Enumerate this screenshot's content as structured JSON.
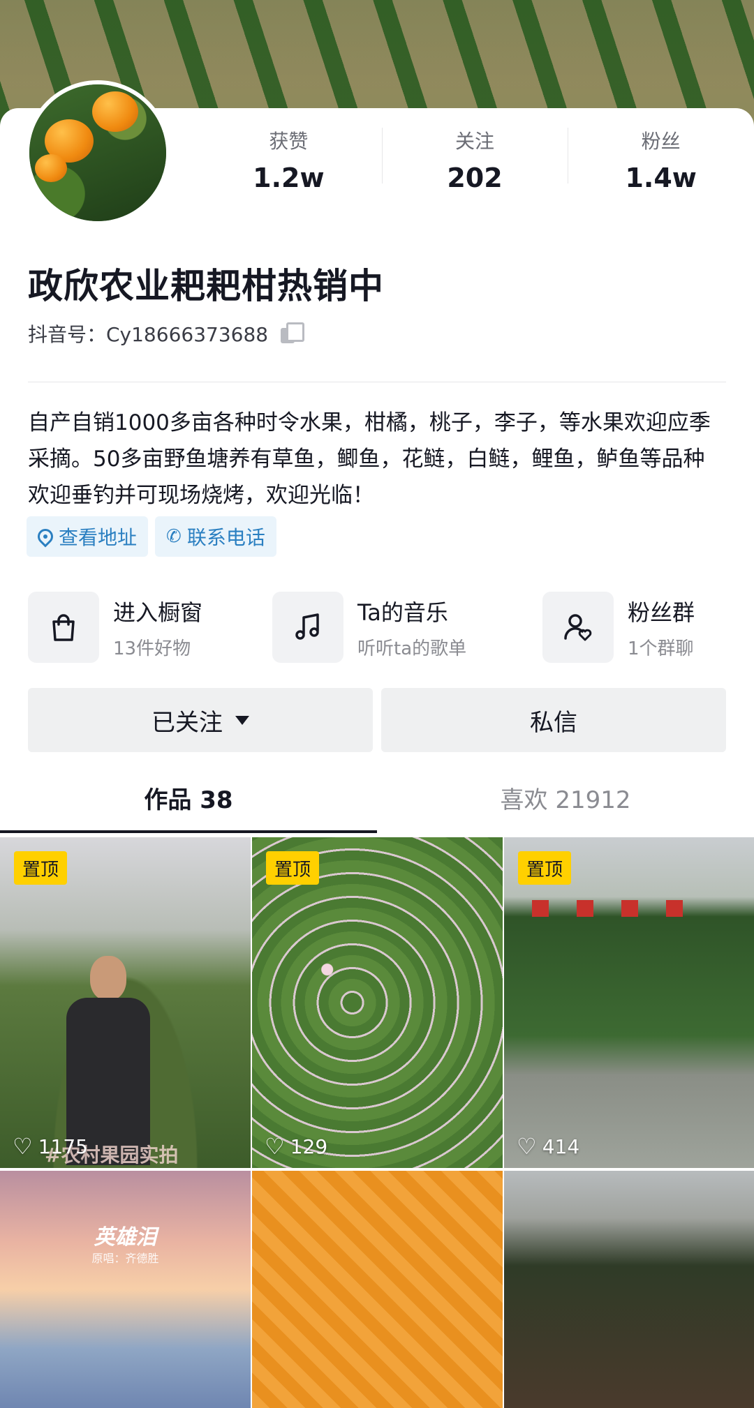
{
  "stats": [
    {
      "label": "获赞",
      "value": "1.2w"
    },
    {
      "label": "关注",
      "value": "202"
    },
    {
      "label": "粉丝",
      "value": "1.4w"
    }
  ],
  "profile": {
    "name": "政欣农业耙耙柑热销中",
    "douyin_id": "抖音号：Cy18666373688",
    "bio": "自产自销1000多亩各种时令水果，柑橘，桃子，李子，等水果欢迎应季采摘。50多亩野鱼塘养有草鱼，鲫鱼，花鲢，白鲢，鲤鱼，鲈鱼等品种欢迎垂钓并可现场烧烤，欢迎光临！"
  },
  "chips": {
    "address": "查看地址",
    "phone": "联系电话"
  },
  "features": [
    {
      "title": "进入橱窗",
      "subtitle": "13件好物",
      "icon": "shopping-bag-icon"
    },
    {
      "title": "Ta的音乐",
      "subtitle": "听听ta的歌单",
      "icon": "music-note-icon"
    },
    {
      "title": "粉丝群",
      "subtitle": "1个群聊",
      "icon": "fan-group-icon"
    }
  ],
  "actions": {
    "followed": "已关注",
    "message": "私信"
  },
  "tabs": [
    {
      "label": "作品 38",
      "active": true
    },
    {
      "label": "喜欢 21912",
      "active": false
    }
  ],
  "grid": {
    "pinned_label": "置顶",
    "videos": [
      {
        "likes": "1175",
        "pinned": true,
        "caption": "#农村果园实拍"
      },
      {
        "likes": "129",
        "pinned": true
      },
      {
        "likes": "414",
        "pinned": true
      },
      {
        "song_title": "英雄泪",
        "song_sub": "原唱：齐德胜"
      },
      {},
      {}
    ]
  },
  "colors": {
    "accent_link": "#2a7fc1",
    "pin_badge": "#ffd000",
    "text_primary": "#161823"
  }
}
